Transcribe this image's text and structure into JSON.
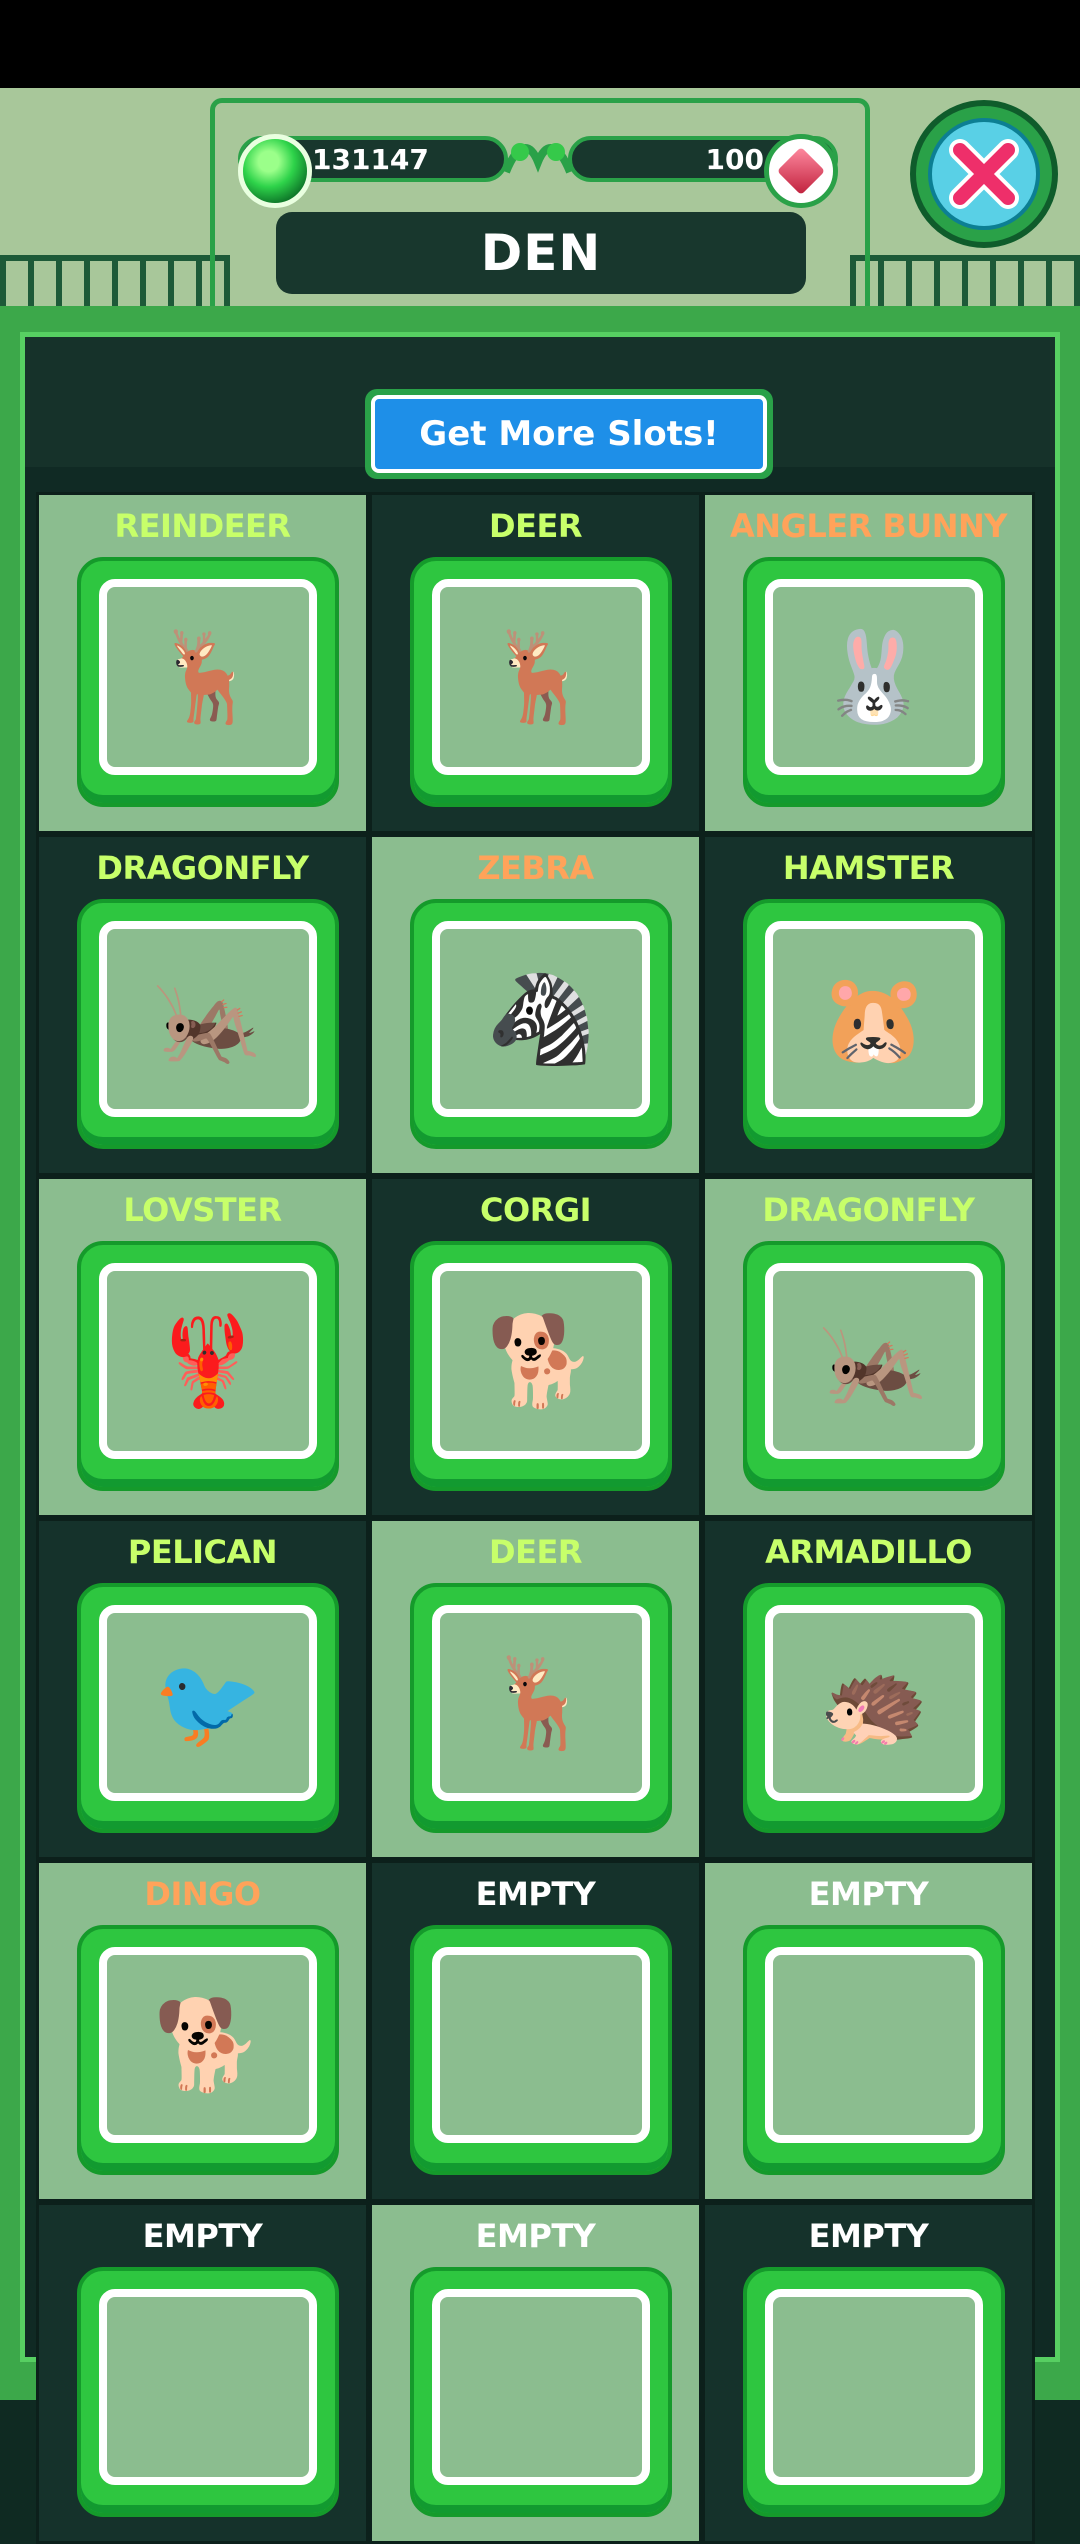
{
  "header": {
    "coins": "131147",
    "gems": "100",
    "title": "DEN"
  },
  "buttons": {
    "more_slots": "Get More Slots!"
  },
  "icons": {
    "coin": "green-gem-coin-icon",
    "gem": "red-crystal-icon",
    "close": "close-x-icon"
  },
  "slots": [
    {
      "name": "REINDEER",
      "color": "green",
      "icon": "🦌"
    },
    {
      "name": "DEER",
      "color": "green",
      "icon": "🦌"
    },
    {
      "name": "ANGLER BUNNY",
      "color": "orange",
      "icon": "🐰"
    },
    {
      "name": "DRAGONFLY",
      "color": "green",
      "icon": "🦗"
    },
    {
      "name": "ZEBRA",
      "color": "orange",
      "icon": "🦓"
    },
    {
      "name": "HAMSTER",
      "color": "green",
      "icon": "🐹"
    },
    {
      "name": "LOVSTER",
      "color": "green",
      "icon": "🦞"
    },
    {
      "name": "CORGI",
      "color": "green",
      "icon": "🐕"
    },
    {
      "name": "DRAGONFLY",
      "color": "green",
      "icon": "🦗"
    },
    {
      "name": "PELICAN",
      "color": "green",
      "icon": "🐦"
    },
    {
      "name": "DEER",
      "color": "green",
      "icon": "🦌"
    },
    {
      "name": "ARMADILLO",
      "color": "green",
      "icon": "🦔"
    },
    {
      "name": "DINGO",
      "color": "orange",
      "icon": "🐕"
    },
    {
      "name": "EMPTY",
      "color": "white",
      "icon": ""
    },
    {
      "name": "EMPTY",
      "color": "white",
      "icon": ""
    },
    {
      "name": "EMPTY",
      "color": "white",
      "icon": ""
    },
    {
      "name": "EMPTY",
      "color": "white",
      "icon": ""
    },
    {
      "name": "EMPTY",
      "color": "white",
      "icon": ""
    }
  ]
}
